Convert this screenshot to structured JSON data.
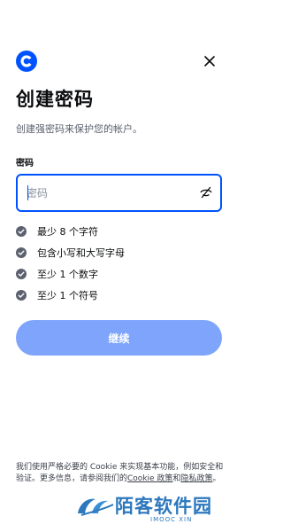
{
  "header": {
    "logo_icon": "coinbase-logo-icon",
    "close_icon": "close-icon"
  },
  "title": "创建密码",
  "subtitle": "创建强密码来保护您的帐户。",
  "password_field": {
    "label": "密码",
    "placeholder": "密码",
    "value": "",
    "toggle_icon": "eye-slash-icon"
  },
  "requirements": [
    {
      "label": "最少 8 个字符",
      "icon": "check-circle-icon"
    },
    {
      "label": "包含小写和大写字母",
      "icon": "check-circle-icon"
    },
    {
      "label": "至少 1 个数字",
      "icon": "check-circle-icon"
    },
    {
      "label": "至少 1 个符号",
      "icon": "check-circle-icon"
    }
  ],
  "continue_label": "继续",
  "footer": {
    "text_1": "我们使用严格必要的 Cookie 来实现基本功能，例如安全和验证。更多信息，请参阅我们的",
    "cookie_link": "Cookie 政策",
    "and": "和",
    "privacy_link": "隐私政策",
    "end": "。"
  },
  "watermark": {
    "title": "陌客软件园",
    "subtitle": "IMOOC XIN"
  },
  "colors": {
    "brand_blue": "#0052ff",
    "button_disabled": "#7ea5fb",
    "check_icon": "#5b616e",
    "watermark": "#2c78bd"
  }
}
